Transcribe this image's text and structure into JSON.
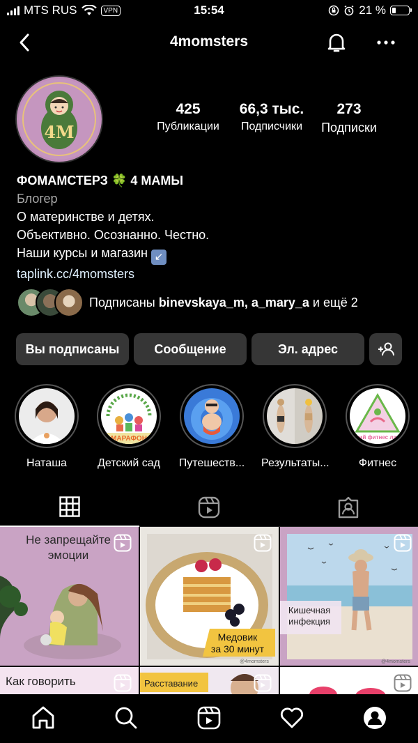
{
  "status": {
    "carrier": "MTS RUS",
    "vpn": "VPN",
    "time": "15:54",
    "battery": "21 %",
    "battery_level": 0.21
  },
  "header": {
    "username": "4momsters"
  },
  "profile": {
    "avatar_text": "4M",
    "stats": [
      {
        "value": "425",
        "label": "Публикации"
      },
      {
        "value": "66,3 тыс.",
        "label": "Подписчики"
      },
      {
        "value": "273",
        "label": "Подписки"
      }
    ],
    "name": "ФОМАМСТЕРЗ 🍀 4 МАМЫ",
    "category": "Блогер",
    "bio_lines": [
      "О материнстве и детях.",
      "Объективно. Осознанно. Честно.",
      "Наши курсы и магазин"
    ],
    "bio_emoji": "↙",
    "link": "taplink.cc/4momsters",
    "followed_prefix": "Подписаны ",
    "followed_names": "binevskaya_m, a_mary_a",
    "followed_suffix": " и ещё 2"
  },
  "buttons": {
    "following": "Вы подписаны",
    "message": "Сообщение",
    "email": "Эл. адрес"
  },
  "highlights": [
    {
      "label": "Наташа"
    },
    {
      "label": "Детский сад",
      "pic_text": "МАРАФОН"
    },
    {
      "label": "Путешеств..."
    },
    {
      "label": "Результаты..."
    },
    {
      "label": "Фитнес",
      "pic_text": "летний фитнес лагерь"
    }
  ],
  "grid": [
    {
      "caption": "Не запрещайте эмоции"
    },
    {
      "caption": "Медовик за 30 минут",
      "watermark": "@4momsters"
    },
    {
      "caption": "Кишечная инфекция",
      "watermark": "@4momsters"
    },
    {
      "caption": "Как говорить"
    },
    {
      "caption": "Расставание"
    },
    {
      "caption": ""
    }
  ],
  "colors": {
    "background": "#000000",
    "button_bg": "#363636",
    "link": "#e0f1ff",
    "muted": "#a8a8a8",
    "pink_post": "#c9a3c4"
  },
  "icons": [
    "back-icon",
    "bell-icon",
    "more-icon",
    "add-person-icon",
    "grid-icon",
    "reels-icon",
    "tagged-icon",
    "home-icon",
    "search-icon",
    "reels-nav-icon",
    "heart-icon",
    "profile-icon"
  ]
}
